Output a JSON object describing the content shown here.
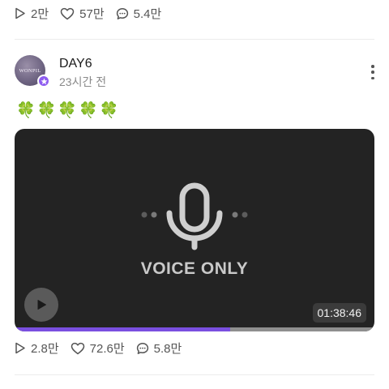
{
  "previous_post": {
    "stats": {
      "views": "2만",
      "likes": "57만",
      "comments": "5.4만"
    }
  },
  "post": {
    "author": "DAY6",
    "time": "23시간 전",
    "avatar_text": "WONPIL",
    "text": "🍀🍀🍀🍀🍀",
    "media": {
      "label": "VOICE ONLY",
      "duration": "01:38:46",
      "progress": 0.6,
      "accent_color": "#7a4fe0"
    },
    "stats": {
      "views": "2.8만",
      "likes": "72.6만",
      "comments": "5.8만"
    }
  },
  "icons": {
    "views": "play-outline-icon",
    "likes": "heart-outline-icon",
    "comments": "chat-bubble-icon",
    "more": "more-vertical-icon",
    "badge": "star-badge-icon",
    "play": "play-icon",
    "mic": "microphone-icon"
  }
}
